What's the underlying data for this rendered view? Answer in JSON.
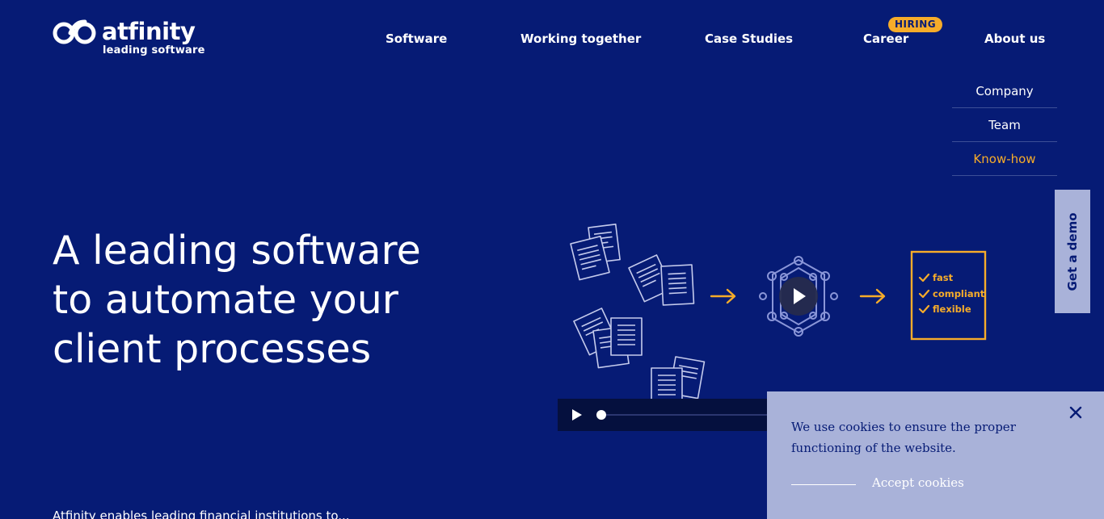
{
  "header": {
    "logo": {
      "word": "atfinity",
      "tagline": "leading software"
    },
    "nav": [
      {
        "label": "Software"
      },
      {
        "label": "Working together"
      },
      {
        "label": "Case Studies"
      },
      {
        "label": "Career",
        "badge": "HIRING"
      },
      {
        "label": "About us"
      }
    ],
    "dropdown": [
      {
        "label": "Company"
      },
      {
        "label": "Team"
      },
      {
        "label": "Know-how",
        "active": true
      }
    ]
  },
  "side_tab": {
    "label": "Get a demo"
  },
  "hero": {
    "title": "A leading software to automate your client processes",
    "bottom_text": "Atfinity enables leading financial institutions to..."
  },
  "illustration": {
    "checklist": [
      "fast",
      "compliant",
      "flexible"
    ]
  },
  "cookie": {
    "text": "We use cookies to ensure the proper functioning of the website.",
    "accept_label": "Accept cookies"
  },
  "colors": {
    "background": "#061b75",
    "accent": "#f6ac2a",
    "panel": "#a9b2d9",
    "illustration_line": "#b4bde8"
  },
  "icons": [
    "logo-infinity-icon",
    "play-icon",
    "close-icon",
    "arrow-right-icon",
    "check-icon",
    "document-icon"
  ]
}
